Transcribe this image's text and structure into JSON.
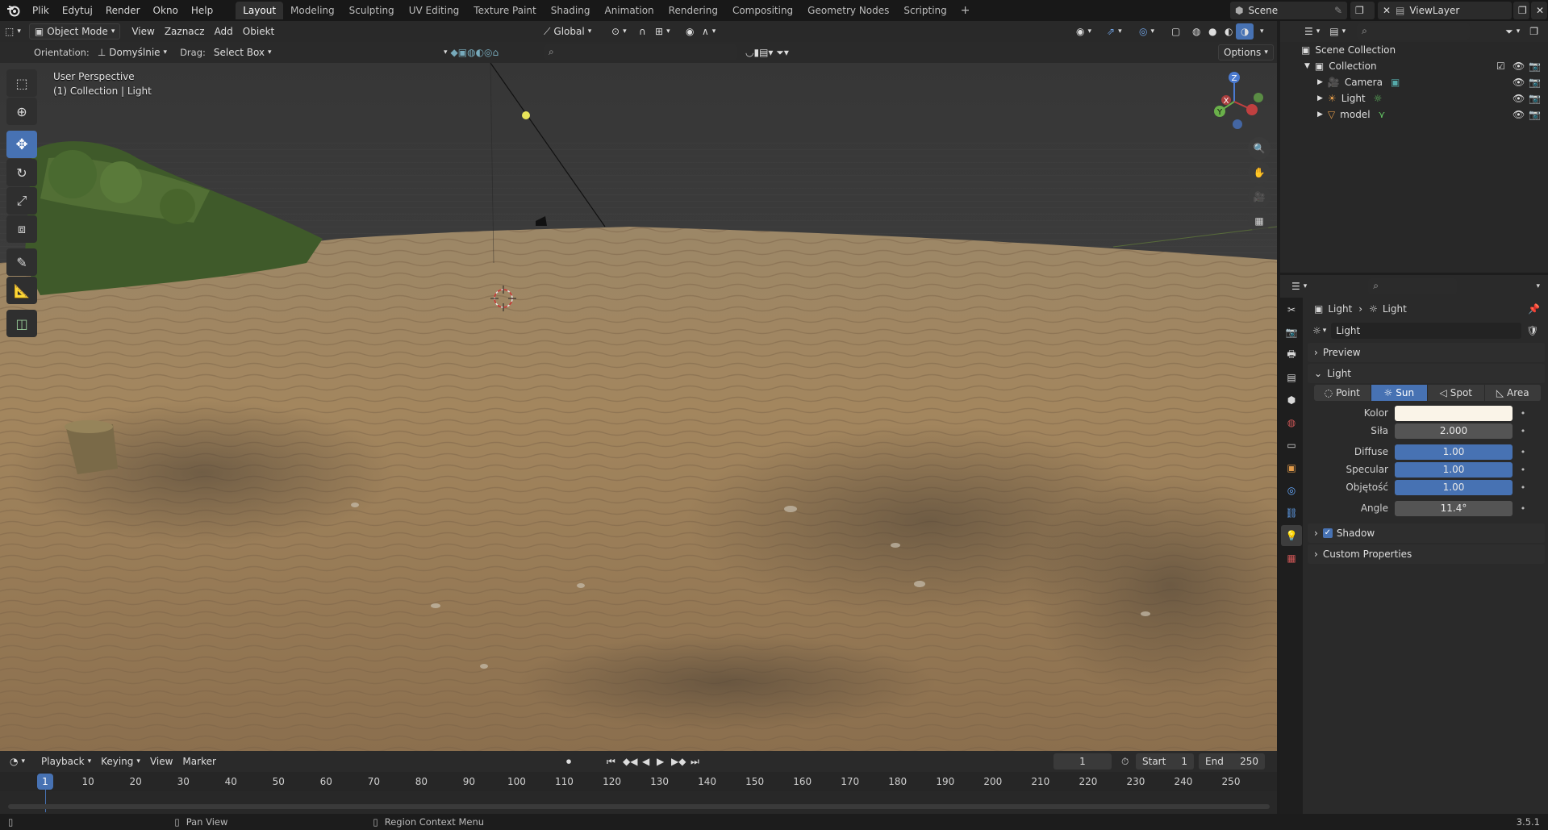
{
  "topbar": {
    "menus": [
      "Plik",
      "Edytuj",
      "Render",
      "Okno",
      "Help"
    ],
    "workspaces": [
      "Layout",
      "Modeling",
      "Sculpting",
      "UV Editing",
      "Texture Paint",
      "Shading",
      "Animation",
      "Rendering",
      "Compositing",
      "Geometry Nodes",
      "Scripting"
    ],
    "active_workspace": "Layout",
    "add_symbol": "+",
    "scene": "Scene",
    "view_layer": "ViewLayer"
  },
  "viewport": {
    "mode": "Object Mode",
    "menus": [
      "View",
      "Zaznacz",
      "Add",
      "Obiekt"
    ],
    "transform_orientation": "Global",
    "orientation_label": "Orientation:",
    "orientation_value": "Domyślnie",
    "drag_label": "Drag:",
    "drag_value": "Select Box",
    "options_label": "Options",
    "info_line1": "User Perspective",
    "info_line2": "(1) Collection | Light",
    "gizmo_axes": [
      "X",
      "Y",
      "Z"
    ]
  },
  "timeline": {
    "menus": [
      "Playback",
      "Keying",
      "View",
      "Marker"
    ],
    "current_frame": "1",
    "start_label": "Start",
    "start_value": "1",
    "end_label": "End",
    "end_value": "250",
    "ticks": [
      "1",
      "10",
      "20",
      "30",
      "40",
      "50",
      "60",
      "70",
      "80",
      "90",
      "100",
      "110",
      "120",
      "130",
      "140",
      "150",
      "160",
      "170",
      "180",
      "190",
      "200",
      "210",
      "220",
      "230",
      "240",
      "250"
    ]
  },
  "statusbar": {
    "hint1": "Pan View",
    "hint2": "Region Context Menu",
    "version": "3.5.1"
  },
  "outliner": {
    "root": "Scene Collection",
    "collection": "Collection",
    "items": [
      {
        "name": "Camera",
        "icon": "camera-icon"
      },
      {
        "name": "Light",
        "icon": "light-icon"
      },
      {
        "name": "model",
        "icon": "mesh-icon"
      }
    ]
  },
  "properties": {
    "breadcrumb_object": "Light",
    "breadcrumb_data": "Light",
    "datablock_name": "Light",
    "panels": {
      "preview": "Preview",
      "light": "Light",
      "shadow": "Shadow",
      "custom": "Custom Properties"
    },
    "light_types": [
      "Point",
      "Sun",
      "Spot",
      "Area"
    ],
    "active_type": "Sun",
    "fields": {
      "color_label": "Kolor",
      "color_value": "#faf4e8",
      "strength_label": "Siła",
      "strength_value": "2.000",
      "diffuse_label": "Diffuse",
      "diffuse_value": "1.00",
      "specular_label": "Specular",
      "specular_value": "1.00",
      "volume_label": "Objętość",
      "volume_value": "1.00",
      "angle_label": "Angle",
      "angle_value": "11.4°"
    },
    "shadow_enabled": true
  },
  "colors": {
    "accent": "#4772b3",
    "selection": "#334d80",
    "bg_dark": "#1d1d1d",
    "panel": "#2a2a2a"
  }
}
